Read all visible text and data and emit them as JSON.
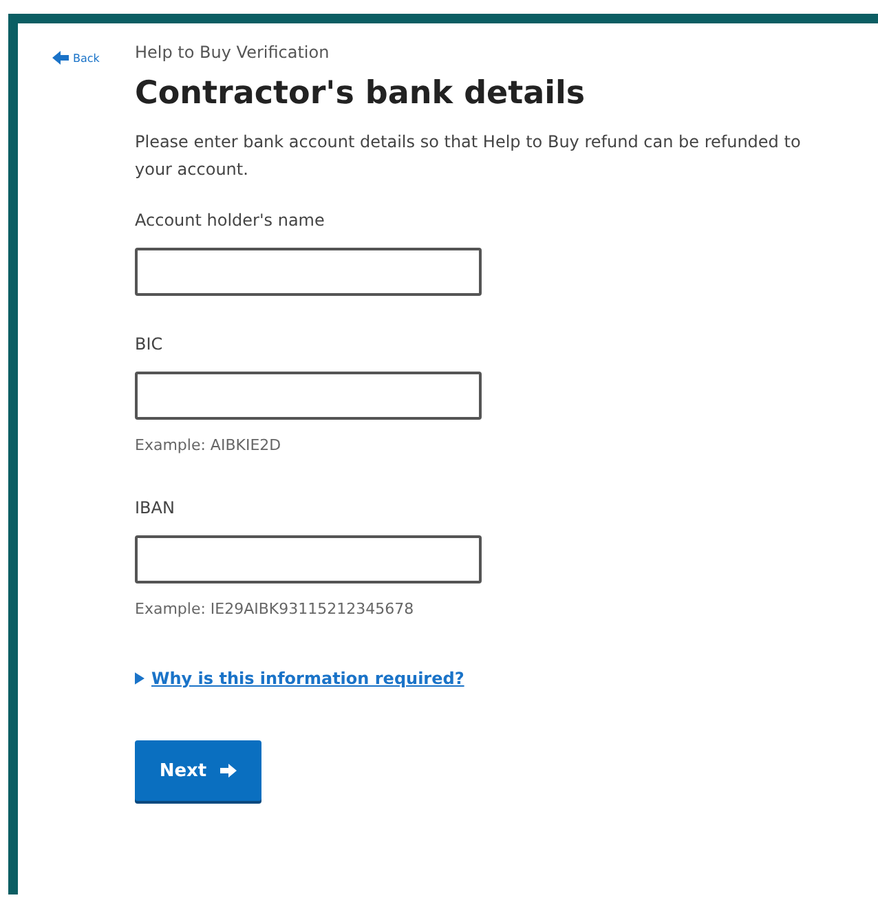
{
  "back_link": "Back",
  "breadcrumb": "Help to Buy Verification",
  "heading": "Contractor's bank details",
  "intro": "Please enter bank account details so that Help to Buy refund can be refunded to your account.",
  "fields": [
    {
      "label": "Account holder's name"
    },
    {
      "label": "BIC",
      "hint": "Example: AIBKIE2D"
    },
    {
      "label": "IBAN",
      "hint": "Example: IE29AIBK93115212345678"
    }
  ],
  "details": {
    "summary": "Why is this information required?",
    "expanded": false
  },
  "next_button": "Next"
}
